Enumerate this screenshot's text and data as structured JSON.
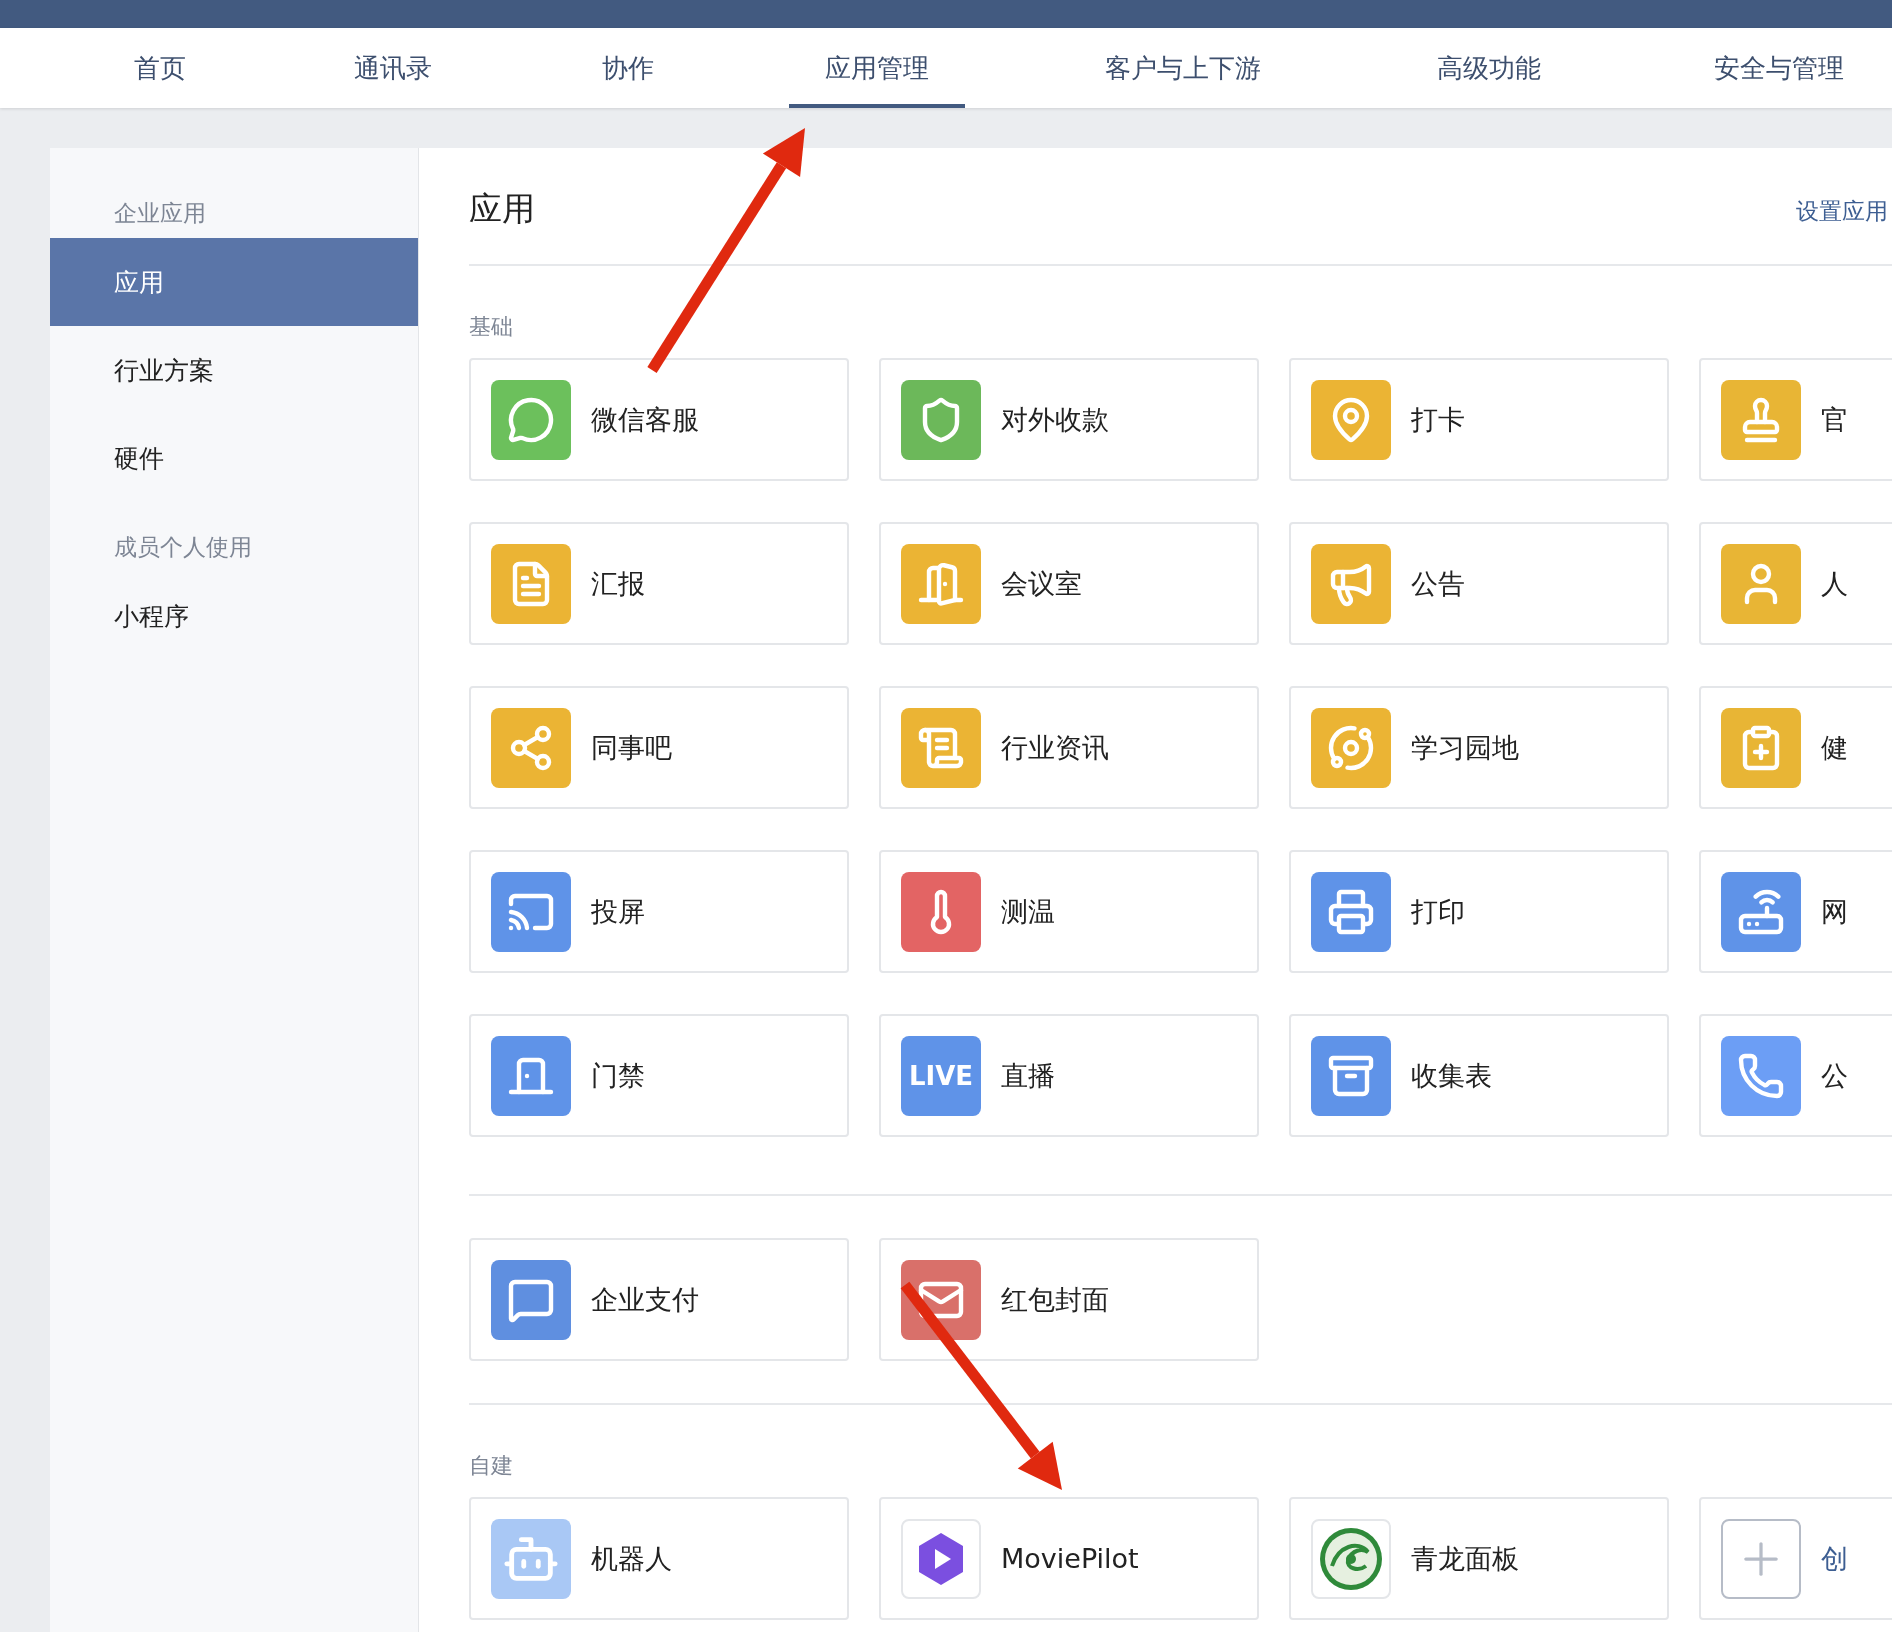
{
  "nav": {
    "tabs": [
      {
        "label": "首页",
        "selected": false
      },
      {
        "label": "通讯录",
        "selected": false
      },
      {
        "label": "协作",
        "selected": false
      },
      {
        "label": "应用管理",
        "selected": true
      },
      {
        "label": "客户与上下游",
        "selected": false
      },
      {
        "label": "高级功能",
        "selected": false
      },
      {
        "label": "安全与管理",
        "selected": false
      }
    ]
  },
  "sidebar": {
    "groups": [
      {
        "heading": "企业应用",
        "items": [
          {
            "label": "应用",
            "selected": true
          },
          {
            "label": "行业方案",
            "selected": false
          },
          {
            "label": "硬件",
            "selected": false
          }
        ]
      },
      {
        "heading": "成员个人使用",
        "items": [
          {
            "label": "小程序",
            "selected": false
          }
        ]
      }
    ]
  },
  "content": {
    "title": "应用",
    "settings_link": "设置应用",
    "sections": [
      {
        "title": "基础",
        "apps": [
          {
            "name": "微信客服",
            "kind": "chat",
            "color": "#6cc05c"
          },
          {
            "name": "对外收款",
            "kind": "yen",
            "color": "#6cb85a"
          },
          {
            "name": "打卡",
            "kind": "pin",
            "color": "#ebb434"
          },
          {
            "name": "官",
            "kind": "stamp",
            "color": "#e8b535"
          },
          {
            "name": "汇报",
            "kind": "doc",
            "color": "#ebb434"
          },
          {
            "name": "会议室",
            "kind": "door",
            "color": "#ebb434"
          },
          {
            "name": "公告",
            "kind": "megaphone",
            "color": "#ebb434"
          },
          {
            "name": "人",
            "kind": "person",
            "color": "#e8b535"
          },
          {
            "name": "同事吧",
            "kind": "nodes",
            "color": "#ebb434"
          },
          {
            "name": "行业资讯",
            "kind": "scroll",
            "color": "#ebb434"
          },
          {
            "name": "学习园地",
            "kind": "planet",
            "color": "#ebb434"
          },
          {
            "name": "健",
            "kind": "clipboard",
            "color": "#e8b535"
          },
          {
            "name": "投屏",
            "kind": "screen",
            "color": "#5f93e8"
          },
          {
            "name": "测温",
            "kind": "thermometer",
            "color": "#e36464"
          },
          {
            "name": "打印",
            "kind": "printer",
            "color": "#5f93e8"
          },
          {
            "name": "网",
            "kind": "router",
            "color": "#5f93e8"
          },
          {
            "name": "门禁",
            "kind": "doorway",
            "color": "#5f93e8"
          },
          {
            "name": "直播",
            "kind": "live",
            "color": "#5f93e8",
            "icon_text": "LIVE"
          },
          {
            "name": "收集表",
            "kind": "box",
            "color": "#5f93e8"
          },
          {
            "name": "公",
            "kind": "phone",
            "color": "#6c9ef5"
          }
        ]
      },
      {
        "apps": [
          {
            "name": "企业支付",
            "kind": "pay",
            "color": "#5f8fe0"
          },
          {
            "name": "红包封面",
            "kind": "envelope",
            "color": "#d9706a"
          }
        ]
      },
      {
        "title": "自建",
        "apps": [
          {
            "name": "机器人",
            "kind": "robot",
            "color": "#a9c8f5"
          },
          {
            "name": "MoviePilot",
            "kind": "play",
            "color": "#ffffff"
          },
          {
            "name": "青龙面板",
            "kind": "dragon",
            "color": "#ffffff"
          },
          {
            "name": "创",
            "kind": "add",
            "color": "#ffffff"
          }
        ]
      }
    ]
  }
}
